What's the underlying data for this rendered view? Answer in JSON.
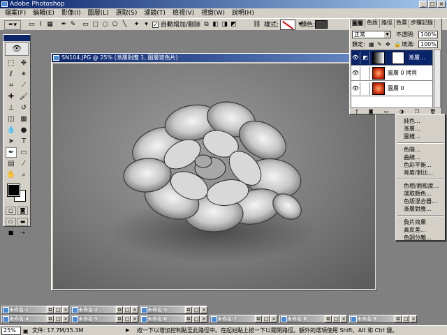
{
  "app": {
    "title": "Adobe Photoshop"
  },
  "menubar": [
    "檔案(F)",
    "編輯(E)",
    "影像(I)",
    "圖層(L)",
    "選取(S)",
    "濾鏡(T)",
    "檢視(V)",
    "視窗(W)",
    "說明(H)"
  ],
  "options": {
    "auto_add_delete": "自動增加/刪除",
    "auto_add_delete_checked": true,
    "style_label": "樣式:",
    "color_label": "顏色:",
    "color_value": "#404040"
  },
  "document": {
    "title": "SN104.JPG @ 25% (漸層對應 1, 圖層遮色片)"
  },
  "layers_panel": {
    "tabs": [
      "圖層",
      "色版",
      "路徑",
      "色票",
      "步驟記錄"
    ],
    "active_tab": "圖層",
    "blend_mode": "正常",
    "opacity_label": "不透明:",
    "opacity_value": "100%",
    "lock_label": "鎖定:",
    "fill_label": "填滿:",
    "fill_value": "100%",
    "layers": [
      {
        "name": "漸層...",
        "selected": true,
        "thumb": "gradient"
      },
      {
        "name": "圖層 0 拷貝",
        "selected": false,
        "thumb": "photo"
      },
      {
        "name": "圖層 0",
        "selected": false,
        "thumb": "photo"
      }
    ]
  },
  "adjustment_menu": {
    "groups": [
      [
        "純色...",
        "漸層...",
        "圖樣..."
      ],
      [
        "色階...",
        "曲線...",
        "色彩平衡...",
        "亮度/對比..."
      ],
      [
        "色相/飽和度...",
        "選取顏色...",
        "色版混合器...",
        "漸層對應..."
      ],
      [
        "負片效果",
        "高反差...",
        "色調分離..."
      ]
    ]
  },
  "minimized_docs": [
    {
      "title": "未命名-1"
    },
    {
      "title": "未命名-2"
    },
    {
      "title": "未命名-3"
    },
    {
      "title": "未命名-4"
    },
    {
      "title": "未命名-5"
    },
    {
      "title": "未命名-6"
    },
    {
      "title": "未命名-7"
    },
    {
      "title": "未命名-8"
    },
    {
      "title": "未命名-9"
    }
  ],
  "status": {
    "zoom": "25%",
    "doc_size": "文件: 17.7M/35.3M",
    "hint": "按一下以增加控制點至此路徑中。在起始點上按一下以關閉路徑。額外的選項使用 Shift、Alt 和 Ctrl 鍵。"
  }
}
